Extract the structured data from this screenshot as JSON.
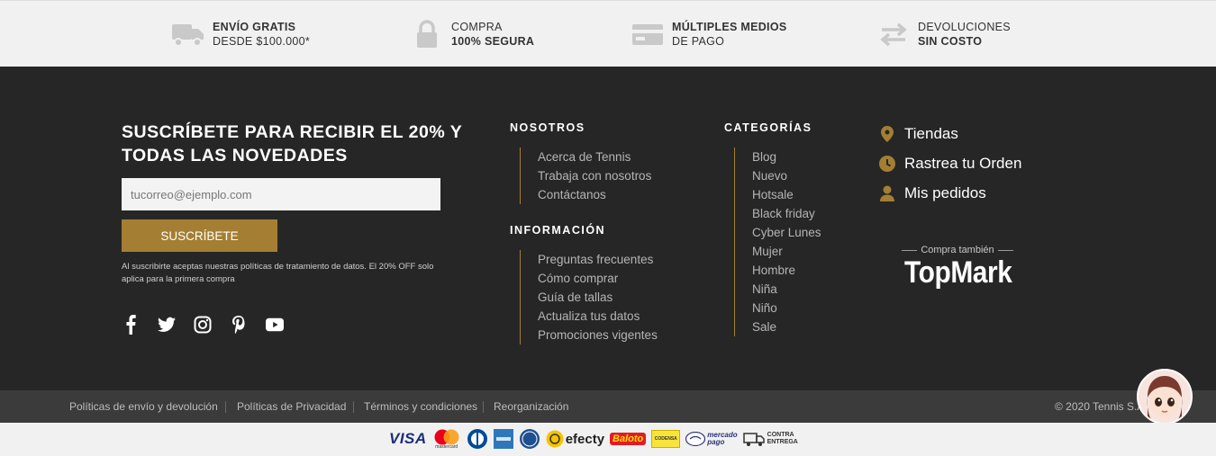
{
  "benefits": [
    {
      "line1": "ENVÍO GRATIS",
      "line2": "DESDE $100.000*",
      "icon": "truck-icon"
    },
    {
      "line1": "COMPRA",
      "line2": "100% SEGURA",
      "icon": "lock-icon"
    },
    {
      "line1": "MÚLTIPLES MEDIOS",
      "line2": "DE PAGO",
      "icon": "card-icon"
    },
    {
      "line1": "DEVOLUCIONES",
      "line2": "SIN COSTO",
      "icon": "exchange-icon"
    }
  ],
  "subscribe": {
    "title": "SUSCRÍBETE PARA RECIBIR EL 20% Y TODAS LAS NOVEDADES",
    "placeholder": "tucorreo@ejemplo.com",
    "button": "SUSCRÍBETE",
    "legal": "Al suscribirte aceptas nuestras políticas de tratamiento de datos. El 20% OFF solo aplica para la primera compra"
  },
  "socials": [
    "facebook-icon",
    "twitter-icon",
    "instagram-icon",
    "pinterest-icon",
    "youtube-icon"
  ],
  "nosotros": {
    "title": "NOSOTROS",
    "links": [
      "Acerca de Tennis",
      "Trabaja con nosotros",
      "Contáctanos"
    ]
  },
  "informacion": {
    "title": "INFORMACIÓN",
    "links": [
      "Preguntas frecuentes",
      "Cómo comprar",
      "Guía de tallas",
      "Actualiza tus datos",
      "Promociones vigentes"
    ]
  },
  "categorias": {
    "title": "CATEGORÍAS",
    "links": [
      "Blog",
      "Nuevo",
      "Hotsale",
      "Black friday",
      "Cyber Lunes",
      "Mujer",
      "Hombre",
      "Niña",
      "Niño",
      "Sale"
    ]
  },
  "quick_links": [
    {
      "label": "Tiendas",
      "icon": "location-pin-icon"
    },
    {
      "label": "Rastrea tu Orden",
      "icon": "clock-icon"
    },
    {
      "label": "Mis pedidos",
      "icon": "user-icon"
    }
  ],
  "topmark": {
    "pre": "Compra también",
    "brand": "TopMark"
  },
  "bottom": {
    "links": [
      "Políticas de envío y devolución",
      "Políticas de Privacidad",
      "Términos y condiciones",
      "Reorganización"
    ],
    "copyright": "© 2020 Tennis S.A"
  },
  "payments": {
    "visa": "VISA",
    "mastercard": "mastercard",
    "efecty": "efecty",
    "baloto": "Baloto",
    "codensa": "CODENSA",
    "mercadopago_1": "mercado",
    "mercadopago_2": "pago",
    "contra_1": "CONTRA",
    "contra_2": "ENTREGA"
  },
  "colors": {
    "accent": "#a47f33",
    "footer_bg": "#262626",
    "bottom_bg": "#3b3b3b",
    "light_bg": "#f1f1f1"
  }
}
